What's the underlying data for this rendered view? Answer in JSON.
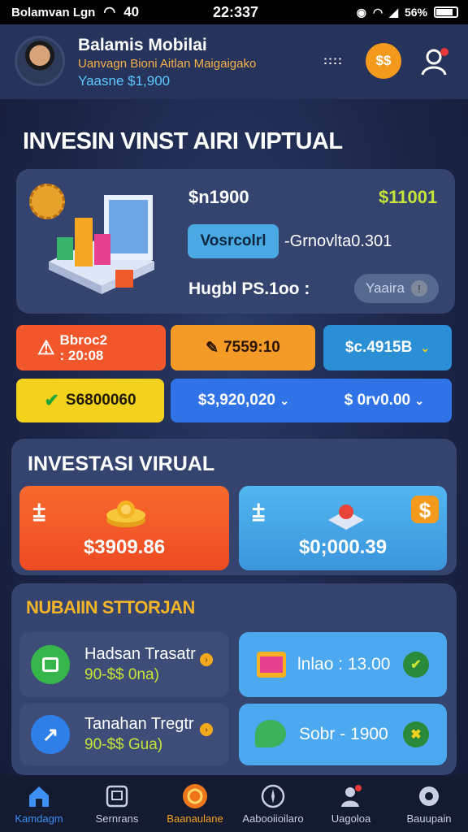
{
  "status_bar": {
    "carrier": "Bolamvan Lgn",
    "signal": "40",
    "time": "22:337",
    "battery": "56%"
  },
  "user": {
    "name": "Balamis Mobilai",
    "subtitle": "Uanvagn Bioni Aitlan Maigaigako",
    "balance": "Yaasne $1,900",
    "menu_text": "::::"
  },
  "header_actions": {
    "coin_label": "$$"
  },
  "page_title": "INVESIN VINST AIRI VIPTUAL",
  "hero": {
    "value_left": "$n1900",
    "value_right": "$11001",
    "button_label": "Vosrcolrl",
    "growth_text": "-Grnovlta0.301",
    "stat_text": "Hugbl PS.1oo :",
    "pill_label": "Yaaira",
    "pill_icon": "info-icon"
  },
  "tiles": {
    "t1_line1": "Bbroc2",
    "t1_line2": ": 20:08",
    "t2": "7559:10",
    "t3": "$c.4915B",
    "t4": "S6800060",
    "t5_left": "$3,920,020",
    "t5_right": "$ 0rv0.00"
  },
  "section2": {
    "title": "INVESTASI VIRUAL",
    "card1_symbol": "⩲",
    "card1_value": "$3909.86",
    "card2_symbol": "⩲",
    "card2_value": "$0;000.39"
  },
  "section3": {
    "title": "NUBAIIN STTORJAN",
    "rows": [
      {
        "title": "Hadsan Trasatr",
        "sub": "90-$$ 0na)"
      },
      {
        "title": "lnlao : 13.00"
      },
      {
        "title": "Tanahan Tregtr",
        "sub": "90-$$ Gua)"
      },
      {
        "title": "Sobr - 1900"
      }
    ]
  },
  "nav": [
    {
      "label": "Kamdagm",
      "icon": "home-icon"
    },
    {
      "label": "Sernrans",
      "icon": "window-icon"
    },
    {
      "label": "Baanaulane",
      "icon": "coin-icon"
    },
    {
      "label": "Aabooiioilaro",
      "icon": "compass-icon"
    },
    {
      "label": "Uagoloa",
      "icon": "user-icon"
    },
    {
      "label": "Bauupain",
      "icon": "settings-icon"
    }
  ],
  "colors": {
    "accent_orange": "#f39a1c",
    "accent_blue": "#2f73e6",
    "accent_yellow": "#f3d21d",
    "accent_red": "#f1572b",
    "background": "#1b2547"
  }
}
